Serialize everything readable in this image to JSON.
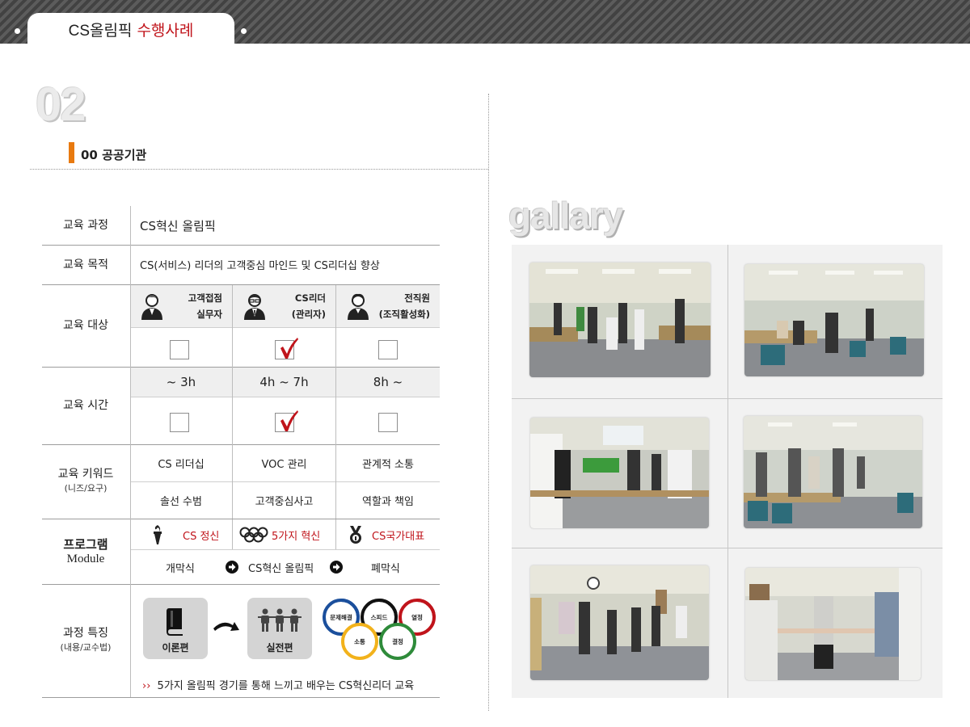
{
  "header": {
    "tab_title": "CS올림픽",
    "tab_accent": "수행사례"
  },
  "section": {
    "number": "02",
    "organization": "00 공공기관"
  },
  "table": {
    "course": {
      "label": "교육 과정",
      "value": "CS혁신 올림픽"
    },
    "purpose": {
      "label": "교육 목적",
      "value": "CS(서비스) 리더의 고객중심 마인드 및 CS리더십 향상"
    },
    "target": {
      "label": "교육 대상",
      "columns": [
        {
          "line1": "고객접점",
          "line2": "실무자",
          "icon": "employee-icon",
          "checked": false
        },
        {
          "line1": "CS리더",
          "line2": "(관리자)",
          "icon": "manager-icon",
          "checked": true
        },
        {
          "line1": "전직원",
          "line2": "(조직활성화)",
          "icon": "staff-icon",
          "checked": false
        }
      ]
    },
    "time": {
      "label": "교육 시간",
      "columns": [
        {
          "value": "~ 3h",
          "checked": false
        },
        {
          "value": "4h ~ 7h",
          "checked": true
        },
        {
          "value": "8h ~",
          "checked": false
        }
      ]
    },
    "keywords": {
      "label": "교육 키워드",
      "sublabel": "(니즈/요구)",
      "row1": [
        "CS 리더십",
        "VOC 관리",
        "관계적 소통"
      ],
      "row2": [
        "솔선 수범",
        "고객중심사고",
        "역할과 책임"
      ]
    },
    "program": {
      "label": "프로그램",
      "label2": "Module",
      "modules": [
        {
          "text": "CS 정신",
          "icon": "torch-icon"
        },
        {
          "text": "5가지 혁신",
          "icon": "olympic-rings-icon"
        },
        {
          "text": "CS국가대표",
          "icon": "medal-icon"
        }
      ],
      "flow": [
        "개막식",
        "CS혁신 올림픽",
        "폐막식"
      ]
    },
    "features": {
      "label": "과정 특징",
      "sublabel": "(내용/교수법)",
      "theory": "이론편",
      "practice": "실전편",
      "rings": [
        "문제해결",
        "스피드",
        "열정",
        "소통",
        "결정"
      ],
      "note": "5가지 올림픽 경기를 통해 느끼고 배우는 CS혁신리더 교육",
      "note_marker": "››"
    }
  },
  "gallery": {
    "title": "gallary",
    "photos": [
      {
        "icon": "workshop-photo"
      },
      {
        "icon": "workshop-photo"
      },
      {
        "icon": "workshop-photo"
      },
      {
        "icon": "workshop-photo"
      },
      {
        "icon": "workshop-photo"
      },
      {
        "icon": "workshop-photo"
      }
    ]
  },
  "colors": {
    "accent_red": "#c0141b",
    "accent_orange": "#e87a10",
    "ring_blue": "#1b4f9c",
    "ring_black": "#111111",
    "ring_red": "#c0141b",
    "ring_yellow": "#f2b21b",
    "ring_green": "#2e8b3a"
  }
}
